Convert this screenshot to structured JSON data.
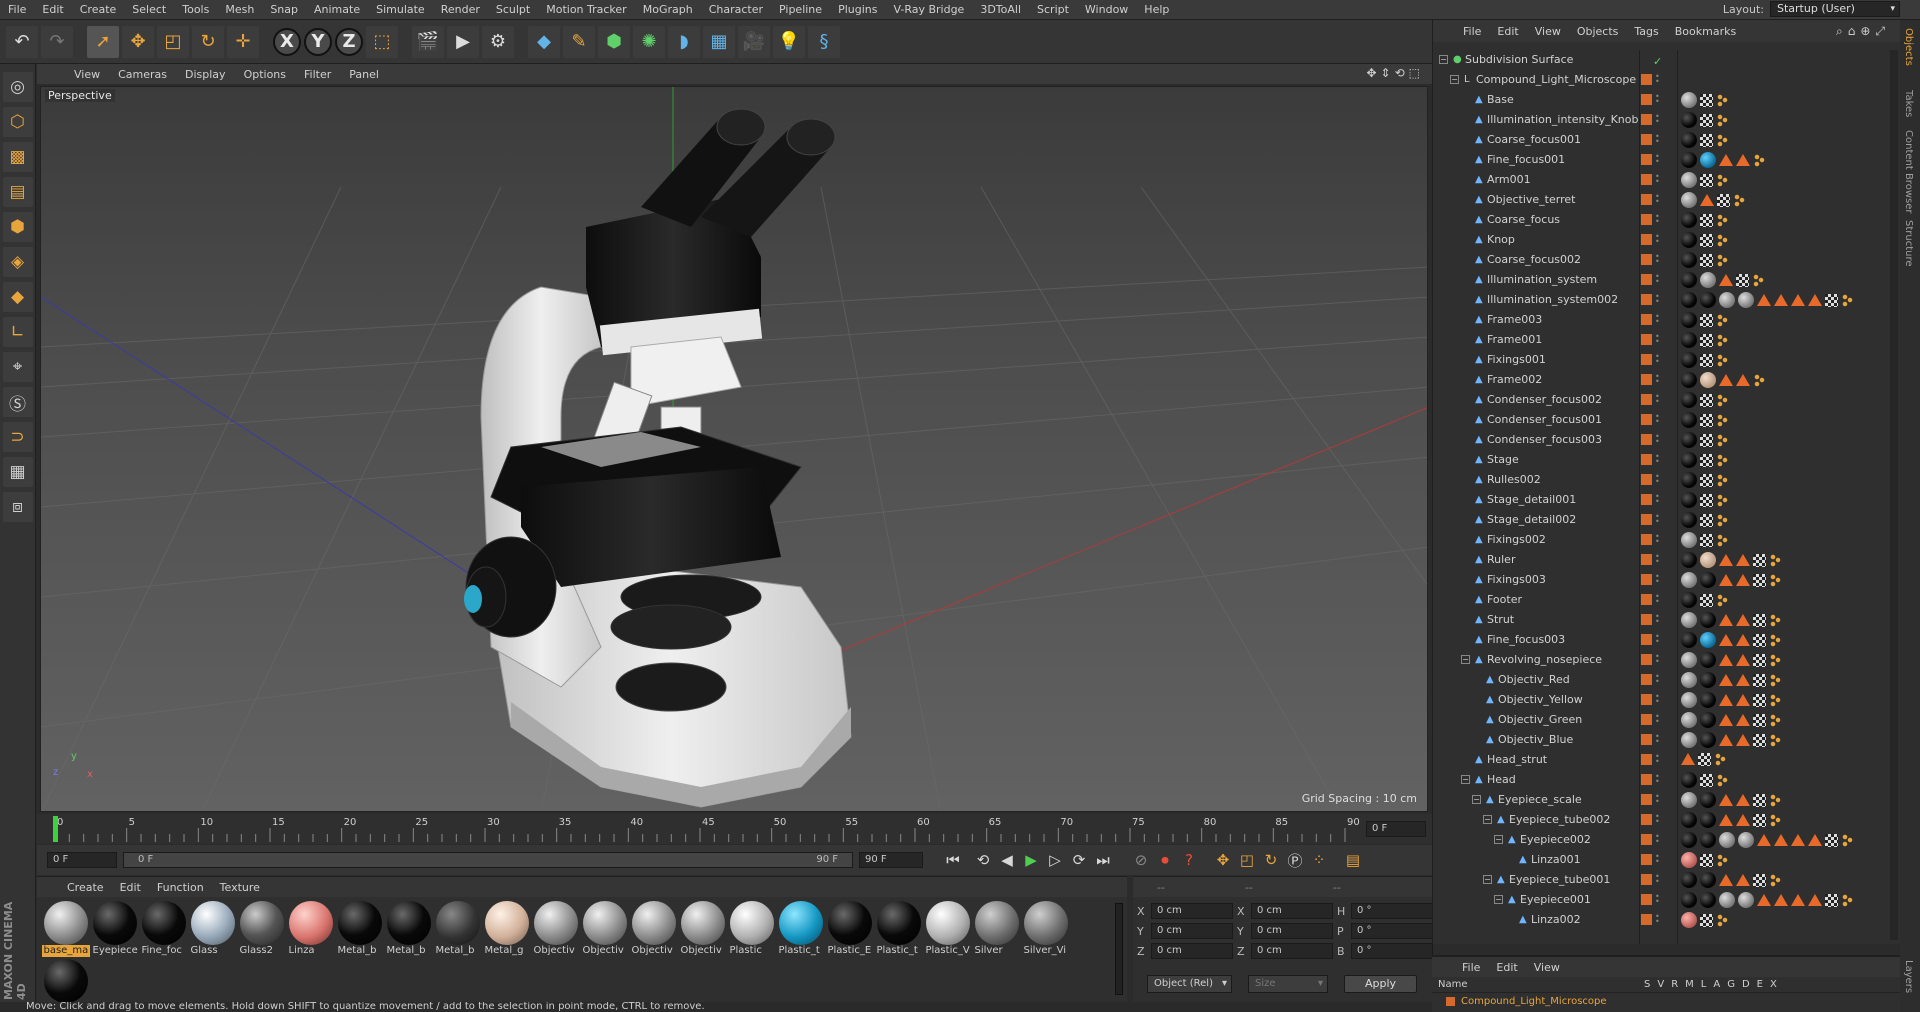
{
  "menubar": {
    "items": [
      "File",
      "Edit",
      "Create",
      "Select",
      "Tools",
      "Mesh",
      "Snap",
      "Animate",
      "Simulate",
      "Render",
      "Sculpt",
      "Motion Tracker",
      "MoGraph",
      "Character",
      "Pipeline",
      "Plugins",
      "V-Ray Bridge",
      "3DToAll",
      "Script",
      "Window",
      "Help"
    ],
    "layout_label": "Layout:",
    "layout_value": "Startup (User)"
  },
  "toolbar": {
    "axis_x": "X",
    "axis_y": "Y",
    "axis_z": "Z"
  },
  "viewport": {
    "menu": [
      "View",
      "Cameras",
      "Display",
      "Options",
      "Filter",
      "Panel"
    ],
    "camera_label": "Perspective",
    "grid_spacing": "Grid Spacing : 10 cm",
    "axis_y": "y",
    "axis_z": "z",
    "axis_x": "x"
  },
  "timeline": {
    "ticks": [
      0,
      5,
      10,
      15,
      20,
      25,
      30,
      35,
      40,
      45,
      50,
      55,
      60,
      65,
      70,
      75,
      80,
      85,
      90
    ],
    "end_field": "0 F"
  },
  "anim": {
    "start_frame": "0 F",
    "range_start": "0 F",
    "range_end": "90 F",
    "end_frame": "90 F"
  },
  "materials": {
    "menu": [
      "Create",
      "Edit",
      "Function",
      "Texture"
    ],
    "items": [
      {
        "name": "base_ma",
        "color": "grey",
        "selected": true
      },
      {
        "name": "Eyepiece",
        "color": "black"
      },
      {
        "name": "Fine_foc",
        "color": "black"
      },
      {
        "name": "Glass",
        "color": "glass"
      },
      {
        "name": "Glass2",
        "color": "darkglass"
      },
      {
        "name": "Linza",
        "color": "pink"
      },
      {
        "name": "Metal_b",
        "color": "black"
      },
      {
        "name": "Metal_b",
        "color": "black"
      },
      {
        "name": "Metal_b",
        "color": "darkgrey"
      },
      {
        "name": "Metal_g",
        "color": "skin"
      },
      {
        "name": "Objectiv",
        "color": "grey"
      },
      {
        "name": "Objectiv",
        "color": "grey"
      },
      {
        "name": "Objectiv",
        "color": "grey"
      },
      {
        "name": "Objectiv",
        "color": "grey"
      },
      {
        "name": "Plastic",
        "color": "lightgrey"
      },
      {
        "name": "Plastic_t",
        "color": "blue"
      },
      {
        "name": "Plastic_E",
        "color": "black"
      },
      {
        "name": "Plastic_t",
        "color": "black"
      },
      {
        "name": "Plastic_V",
        "color": "lightgrey"
      },
      {
        "name": "Silver",
        "color": "midgrey"
      },
      {
        "name": "Silver_Vi",
        "color": "midgrey"
      },
      {
        "name": "",
        "color": "black"
      }
    ]
  },
  "coords": {
    "head": [
      "--",
      "--",
      "--"
    ],
    "rows": [
      {
        "a": "X",
        "av": "0 cm",
        "b": "X",
        "bv": "0 cm",
        "c": "H",
        "cv": "0 °"
      },
      {
        "a": "Y",
        "av": "0 cm",
        "b": "Y",
        "bv": "0 cm",
        "c": "P",
        "cv": "0 °"
      },
      {
        "a": "Z",
        "av": "0 cm",
        "b": "Z",
        "bv": "0 cm",
        "c": "B",
        "cv": "0 °"
      }
    ],
    "mode": "Object (Rel)",
    "size": "Size",
    "apply": "Apply"
  },
  "status": "Move: Click and drag to move elements. Hold down SHIFT to quantize movement / add to the selection in point mode, CTRL to remove.",
  "objects": {
    "menu": [
      "File",
      "Edit",
      "View",
      "Objects",
      "Tags",
      "Bookmarks"
    ],
    "rows": [
      {
        "name": "Subdivision Surface",
        "depth": 0,
        "toggle": "-",
        "tags": "check",
        "kind": "sds"
      },
      {
        "name": "Compound_Light_Microscope",
        "depth": 1,
        "toggle": "-",
        "tags": "",
        "kind": "null"
      },
      {
        "name": "Base",
        "depth": 2,
        "tags": "g c d"
      },
      {
        "name": "Illumination_intensity_Knob",
        "depth": 2,
        "tags": "k c d"
      },
      {
        "name": "Coarse_focus001",
        "depth": 2,
        "tags": "k c d"
      },
      {
        "name": "Fine_focus001",
        "depth": 2,
        "tags": "k b t t d"
      },
      {
        "name": "Arm001",
        "depth": 2,
        "tags": "g c d"
      },
      {
        "name": "Objective_terret",
        "depth": 2,
        "tags": "g t c d"
      },
      {
        "name": "Coarse_focus",
        "depth": 2,
        "tags": "k c d"
      },
      {
        "name": "Knop",
        "depth": 2,
        "tags": "k c d"
      },
      {
        "name": "Coarse_focus002",
        "depth": 2,
        "tags": "k c d"
      },
      {
        "name": "Illumination_system",
        "depth": 2,
        "tags": "k g t c d"
      },
      {
        "name": "Illumination_system002",
        "depth": 2,
        "tags": "k k g g t t t t c d"
      },
      {
        "name": "Frame003",
        "depth": 2,
        "tags": "k c d"
      },
      {
        "name": "Frame001",
        "depth": 2,
        "tags": "k c d"
      },
      {
        "name": "Fixings001",
        "depth": 2,
        "tags": "k c d"
      },
      {
        "name": "Frame002",
        "depth": 2,
        "tags": "k s t t d"
      },
      {
        "name": "Condenser_focus002",
        "depth": 2,
        "tags": "k c d"
      },
      {
        "name": "Condenser_focus001",
        "depth": 2,
        "tags": "k c d"
      },
      {
        "name": "Condenser_focus003",
        "depth": 2,
        "tags": "k c d"
      },
      {
        "name": "Stage",
        "depth": 2,
        "tags": "k c d"
      },
      {
        "name": "Rulles002",
        "depth": 2,
        "tags": "k c d"
      },
      {
        "name": "Stage_detail001",
        "depth": 2,
        "tags": "k c d"
      },
      {
        "name": "Stage_detail002",
        "depth": 2,
        "tags": "k c d"
      },
      {
        "name": "Fixings002",
        "depth": 2,
        "tags": "g c d"
      },
      {
        "name": "Ruler",
        "depth": 2,
        "tags": "k s t t c d"
      },
      {
        "name": "Fixings003",
        "depth": 2,
        "tags": "g k t t c d"
      },
      {
        "name": "Footer",
        "depth": 2,
        "tags": "k c d"
      },
      {
        "name": "Strut",
        "depth": 2,
        "tags": "g k t t c d"
      },
      {
        "name": "Fine_focus003",
        "depth": 2,
        "tags": "k b t t c d"
      },
      {
        "name": "Revolving_nosepiece",
        "depth": 2,
        "toggle": "-",
        "tags": "g k t t c d"
      },
      {
        "name": "Objectiv_Red",
        "depth": 3,
        "tags": "g k t t c d"
      },
      {
        "name": "Objectiv_Yellow",
        "depth": 3,
        "tags": "g k t t c d"
      },
      {
        "name": "Objectiv_Green",
        "depth": 3,
        "tags": "g k t t c d"
      },
      {
        "name": "Objectiv_Blue",
        "depth": 3,
        "tags": "g k t t c d"
      },
      {
        "name": "Head_strut",
        "depth": 2,
        "tags": "t c d"
      },
      {
        "name": "Head",
        "depth": 2,
        "toggle": "-",
        "tags": "k c d"
      },
      {
        "name": "Eyepiece_scale",
        "depth": 3,
        "toggle": "-",
        "tags": "g k t t c d"
      },
      {
        "name": "Eyepiece_tube002",
        "depth": 4,
        "toggle": "-",
        "tags": "k k t t c d"
      },
      {
        "name": "Eyepiece002",
        "depth": 5,
        "toggle": "-",
        "tags": "k k g g t t t t c d"
      },
      {
        "name": "Linza001",
        "depth": 6,
        "tags": "p c d"
      },
      {
        "name": "Eyepiece_tube001",
        "depth": 4,
        "toggle": "-",
        "tags": "k k t t c d"
      },
      {
        "name": "Eyepiece001",
        "depth": 5,
        "toggle": "-",
        "tags": "k k g g t t t t c d"
      },
      {
        "name": "Linza002",
        "depth": 6,
        "tags": "p c d"
      }
    ]
  },
  "side_tabs": [
    "Objects",
    "Takes",
    "Content Browser",
    "Structure",
    "Layers"
  ],
  "layers": {
    "menu": [
      "File",
      "Edit",
      "View"
    ],
    "head_name": "Name",
    "head_cols": [
      "S",
      "V",
      "R",
      "M",
      "L",
      "A",
      "G",
      "D",
      "E",
      "X"
    ],
    "row": "Compound_Light_Microscope"
  }
}
